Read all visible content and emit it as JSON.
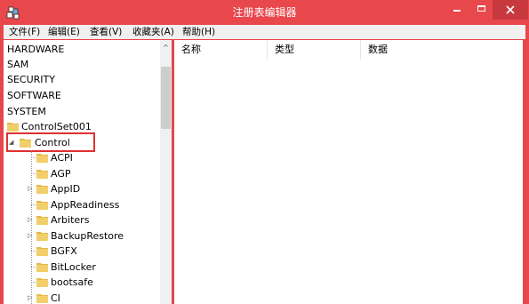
{
  "window": {
    "title": "注册表编辑器",
    "icons": {
      "app": "regedit-icon",
      "minimize": "minimize-icon",
      "maximize": "maximize-icon",
      "close": "close-icon"
    }
  },
  "menu": [
    {
      "label": "文件(F)"
    },
    {
      "label": "编辑(E)"
    },
    {
      "label": "查看(V)"
    },
    {
      "label": "收藏夹(A)"
    },
    {
      "label": "帮助(H)"
    }
  ],
  "tree": {
    "root_keys": [
      "HARDWARE",
      "SAM",
      "SECURITY",
      "SOFTWARE",
      "SYSTEM"
    ],
    "controlset": "ControlSet001",
    "selected": "Control",
    "children": [
      "ACPI",
      "AGP",
      "AppID",
      "AppReadiness",
      "Arbiters",
      "BackupRestore",
      "BGFX",
      "BitLocker",
      "bootsafe",
      "CI"
    ],
    "expander_collapsed": "▷",
    "expander_expanded": "◢"
  },
  "scrollbar": {
    "up_arrow": "^"
  },
  "list": {
    "columns": [
      "名称",
      "类型",
      "数据"
    ]
  },
  "colors": {
    "titlebar": "#e8474c",
    "highlight_border": "#e03030",
    "folder": "#e6b84a"
  }
}
